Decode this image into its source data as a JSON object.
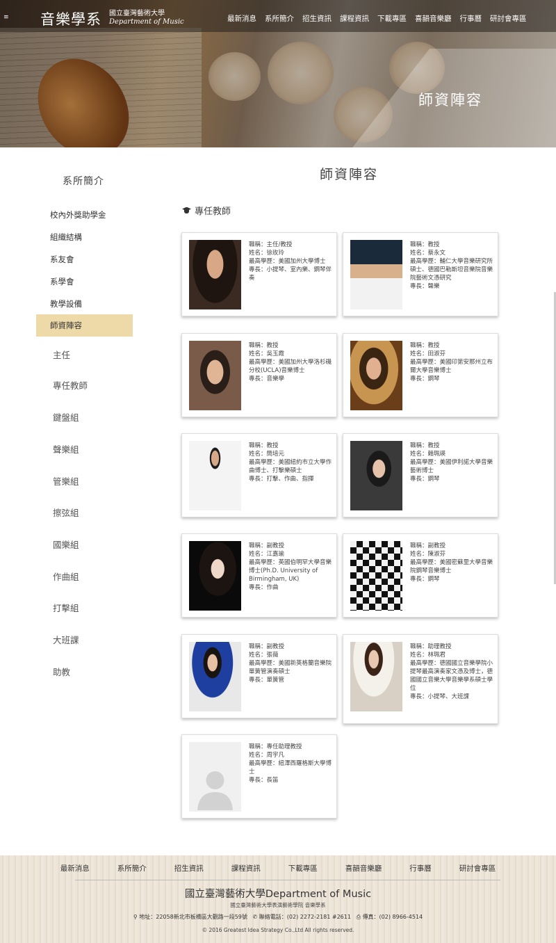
{
  "header": {
    "menu_icon": "≡",
    "logo_zh": "音樂學系",
    "logo_school": "國立臺灣藝術大學",
    "logo_en": "Department of Music",
    "nav": [
      "最新消息",
      "系所簡介",
      "招生資訊",
      "課程資訊",
      "下載專區",
      "喜韻音樂廳",
      "行事曆",
      "研討會專區"
    ],
    "banner_title": "師資陣容"
  },
  "sidebar": {
    "title": "系所簡介",
    "items": [
      "校內外獎助學金",
      "組織結構",
      "系友會",
      "系學會",
      "教學設備",
      "師資陣容"
    ],
    "active": "師資陣容",
    "sub_items": [
      "主任",
      "專任教師",
      "鍵盤組",
      "聲樂組",
      "管樂組",
      "擦弦組",
      "國樂組",
      "作曲組",
      "打擊組",
      "大班課",
      "助教"
    ]
  },
  "main": {
    "title": "師資陣容",
    "section": "專任教師",
    "cards": [
      {
        "lines": [
          "職稱：主任/教授",
          "姓名：徐玫玲",
          "最高學歷：美國加州大學博士",
          "專長：小提琴、室內樂、鋼琴伴奏"
        ]
      },
      {
        "lines": [
          "職稱：教授",
          "姓名：蔡永文",
          "最高學歷：輔仁大學音樂研究所碩士、德國巴勒斯坦音樂院音樂院藝術文憑研究",
          "專長：聲樂"
        ]
      },
      {
        "lines": [
          "職稱：教授",
          "姓名：吳玉霞",
          "最高學歷：美國加州大學洛杉磯分校(UCLA)音樂博士",
          "專長：音樂學"
        ]
      },
      {
        "lines": [
          "職稱：教授",
          "姓名：田淑芬",
          "最高學歷：美國印第安那州立布爾大學音樂博士",
          "專長：鋼琴"
        ]
      },
      {
        "lines": [
          "職稱：教授",
          "姓名：簡培元",
          "最高學歷：美國紐約市立大學作曲博士、打擊樂碩士",
          "專長：打擊、作曲、指揮"
        ]
      },
      {
        "lines": [
          "職稱：教授",
          "姓名：賴珮瑛",
          "最高學歷：美國伊利諾大學音樂藝術博士",
          "專長：鋼琴"
        ]
      },
      {
        "lines": [
          "職稱：副教授",
          "姓名：江嘉瑜",
          "最高學歷：英國伯明罕大學音樂博士(Ph.D. University of Birmingham, UK)",
          "專長：作曲"
        ]
      },
      {
        "lines": [
          "職稱：副教授",
          "姓名：陳淑芬",
          "最高學歷：美國密蘇里大學音樂院鋼琴音樂博士",
          "專長：鋼琴"
        ]
      },
      {
        "lines": [
          "職稱：副教授",
          "姓名：張薇",
          "最高學歷：美國新英格蘭音樂院單簧管演奏碩士",
          "專長：單簧管"
        ]
      },
      {
        "lines": [
          "職稱：助理教授",
          "姓名：林珮君",
          "最高學歷：德國國立音樂學院小提琴最高演奏家文憑及博士，德國國立音樂大學音樂學系碩士學位",
          "專長：小提琴、大班課"
        ]
      },
      {
        "lines": [
          "職稱：專任助理教授",
          "姓名：周宇凡",
          "最高學歷：紐澤西羅格斯大學博士",
          "專長：長笛"
        ]
      }
    ]
  },
  "footer": {
    "nav": [
      "最新消息",
      "系所簡介",
      "招生資訊",
      "課程資訊",
      "下載專區",
      "喜韻音樂廳",
      "行事曆",
      "研討會專區"
    ],
    "name": "國立臺灣藝術大學Department of Music",
    "sub": "國立臺灣藝術大學表演藝術學院 音樂學系",
    "address": "地址：22058新北市板橋區大觀路一段59號",
    "phone": "聯絡電話：(02) 2272-2181 #2611",
    "fax": "傳真：(02) 8966-4514",
    "copyright": "© 2016 Greatest Idea Strategy Co.,Ltd All rights reserved."
  }
}
